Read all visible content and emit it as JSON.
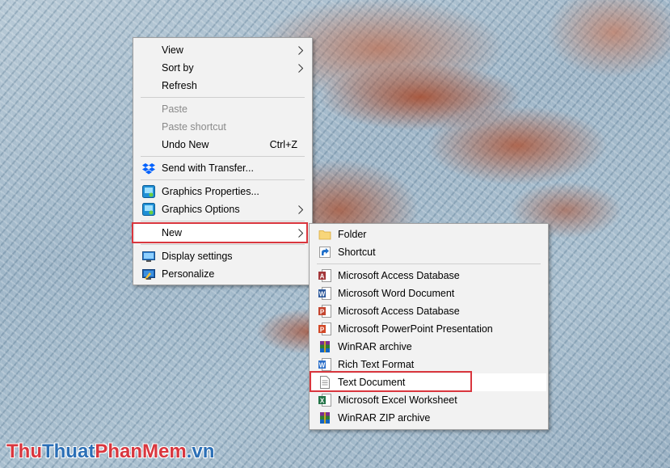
{
  "context_menu": {
    "items": [
      {
        "label": "View",
        "has_submenu": true
      },
      {
        "label": "Sort by",
        "has_submenu": true
      },
      {
        "label": "Refresh"
      },
      {
        "label": "Paste",
        "disabled": true
      },
      {
        "label": "Paste shortcut",
        "disabled": true
      },
      {
        "label": "Undo New",
        "shortcut": "Ctrl+Z"
      },
      {
        "label": "Send with Transfer...",
        "icon": "dropbox-icon"
      },
      {
        "label": "Graphics Properties...",
        "icon": "intel-graphics-icon"
      },
      {
        "label": "Graphics Options",
        "icon": "intel-graphics-icon",
        "has_submenu": true
      },
      {
        "label": "New",
        "has_submenu": true,
        "highlighted": true
      },
      {
        "label": "Display settings",
        "icon": "display-icon"
      },
      {
        "label": "Personalize",
        "icon": "personalize-icon"
      }
    ]
  },
  "new_submenu": {
    "items": [
      {
        "label": "Folder",
        "icon": "folder-icon"
      },
      {
        "label": "Shortcut",
        "icon": "shortcut-icon"
      },
      {
        "label": "Microsoft Access Database",
        "icon": "access-icon"
      },
      {
        "label": "Microsoft Word Document",
        "icon": "word-icon"
      },
      {
        "label": "Microsoft Access Database",
        "icon": "access-icon"
      },
      {
        "label": "Microsoft PowerPoint Presentation",
        "icon": "powerpoint-icon"
      },
      {
        "label": "WinRAR archive",
        "icon": "winrar-icon"
      },
      {
        "label": "Rich Text Format",
        "icon": "wordpad-icon"
      },
      {
        "label": "Text Document",
        "icon": "text-document-icon",
        "highlighted": true
      },
      {
        "label": "Microsoft Excel Worksheet",
        "icon": "excel-icon"
      },
      {
        "label": "WinRAR ZIP archive",
        "icon": "winrar-zip-icon"
      }
    ]
  },
  "watermark": {
    "part1": "Thu",
    "part2": "Thuat",
    "part3": "PhanMem",
    "part4": ".vn",
    "colors": [
      "#d9363e",
      "#2b6fb6",
      "#d9363e",
      "#2b6fb6"
    ]
  },
  "colors": {
    "menu_bg": "#f2f2f2",
    "highlight_box": "#d9363e",
    "disabled_text": "#8a8a8a"
  }
}
